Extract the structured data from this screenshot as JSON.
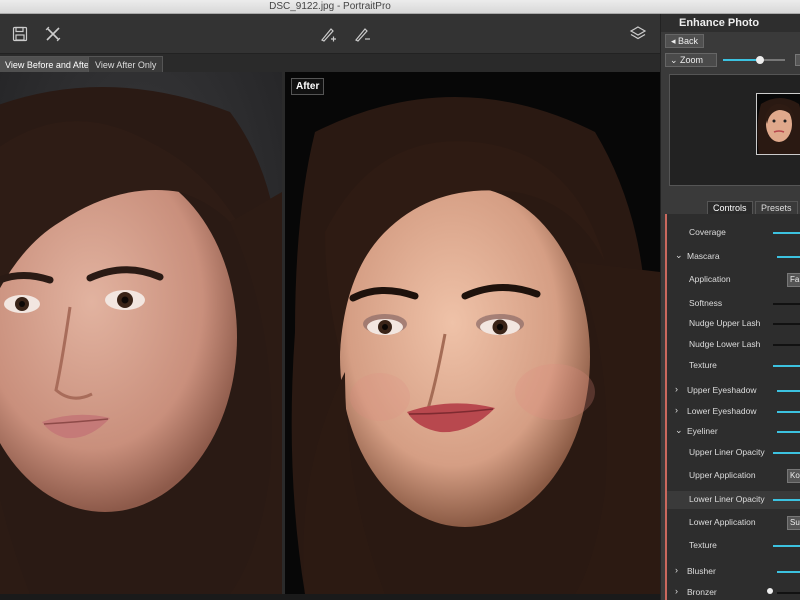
{
  "window": {
    "title": "DSC_9122.jpg - PortraitPro"
  },
  "toolbar": {
    "icons": [
      "save-icon",
      "close-icon",
      "brush-add-icon",
      "brush-remove-icon",
      "layers-icon"
    ]
  },
  "view_tabs": [
    {
      "label": "View Before and After",
      "active": true
    },
    {
      "label": "View After Only",
      "active": false
    }
  ],
  "after_label": "After",
  "panel": {
    "title": "Enhance Photo",
    "back_label": "Back",
    "zoom_label": "Zoom",
    "zoom_level": 0.6,
    "tabs": [
      {
        "label": "Controls",
        "active": true
      },
      {
        "label": "Presets",
        "active": false
      }
    ],
    "controls": [
      {
        "label": "Coverage",
        "type": "slider"
      },
      {
        "label": "Mascara",
        "type": "section",
        "expanded": true
      },
      {
        "label": "Application",
        "type": "select",
        "value": "Fa"
      },
      {
        "label": "Softness",
        "type": "slider-dark"
      },
      {
        "label": "Nudge Upper Lash",
        "type": "slider-dark"
      },
      {
        "label": "Nudge Lower Lash",
        "type": "slider-dark"
      },
      {
        "label": "Texture",
        "type": "slider"
      },
      {
        "label": "Upper Eyeshadow",
        "type": "section",
        "expanded": false
      },
      {
        "label": "Lower Eyeshadow",
        "type": "section",
        "expanded": false
      },
      {
        "label": "Eyeliner",
        "type": "section",
        "expanded": true
      },
      {
        "label": "Upper Liner Opacity",
        "type": "slider"
      },
      {
        "label": "Upper Application",
        "type": "select",
        "value": "Ko"
      },
      {
        "label": "Lower Liner Opacity",
        "type": "slider",
        "highlight": true
      },
      {
        "label": "Lower Application",
        "type": "select",
        "value": "Su"
      },
      {
        "label": "Texture",
        "type": "slider"
      },
      {
        "label": "Blusher",
        "type": "section",
        "expanded": false
      },
      {
        "label": "Bronzer",
        "type": "section",
        "expanded": false
      }
    ]
  },
  "colors": {
    "accent": "#3cc2e0",
    "marker": "#c9685d"
  }
}
